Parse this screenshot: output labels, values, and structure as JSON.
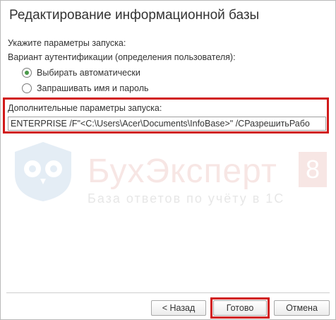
{
  "dialog": {
    "title": "Редактирование информационной базы"
  },
  "form": {
    "startup_params_label": "Укажите параметры запуска:",
    "auth_label": "Вариант аутентификации (определения пользователя):",
    "auth_options": [
      {
        "label": "Выбирать автоматически",
        "checked": true
      },
      {
        "label": "Запрашивать имя и пароль",
        "checked": false
      }
    ],
    "extra_params_label": "Дополнительные параметры запуска:",
    "extra_params_value": "ENTERPRISE /F\"<C:\\Users\\Acer\\Documents\\InfoBase>\" /CРазрешитьРабо"
  },
  "watermark": {
    "brand": "БухЭксперт",
    "badge": "8",
    "tagline": "База ответов по учёту в 1С"
  },
  "buttons": {
    "back": "< Назад",
    "ok": "Готово",
    "cancel": "Отмена"
  },
  "colors": {
    "highlight": "#d11a1a",
    "radio_selected": "#4a9a4a"
  }
}
